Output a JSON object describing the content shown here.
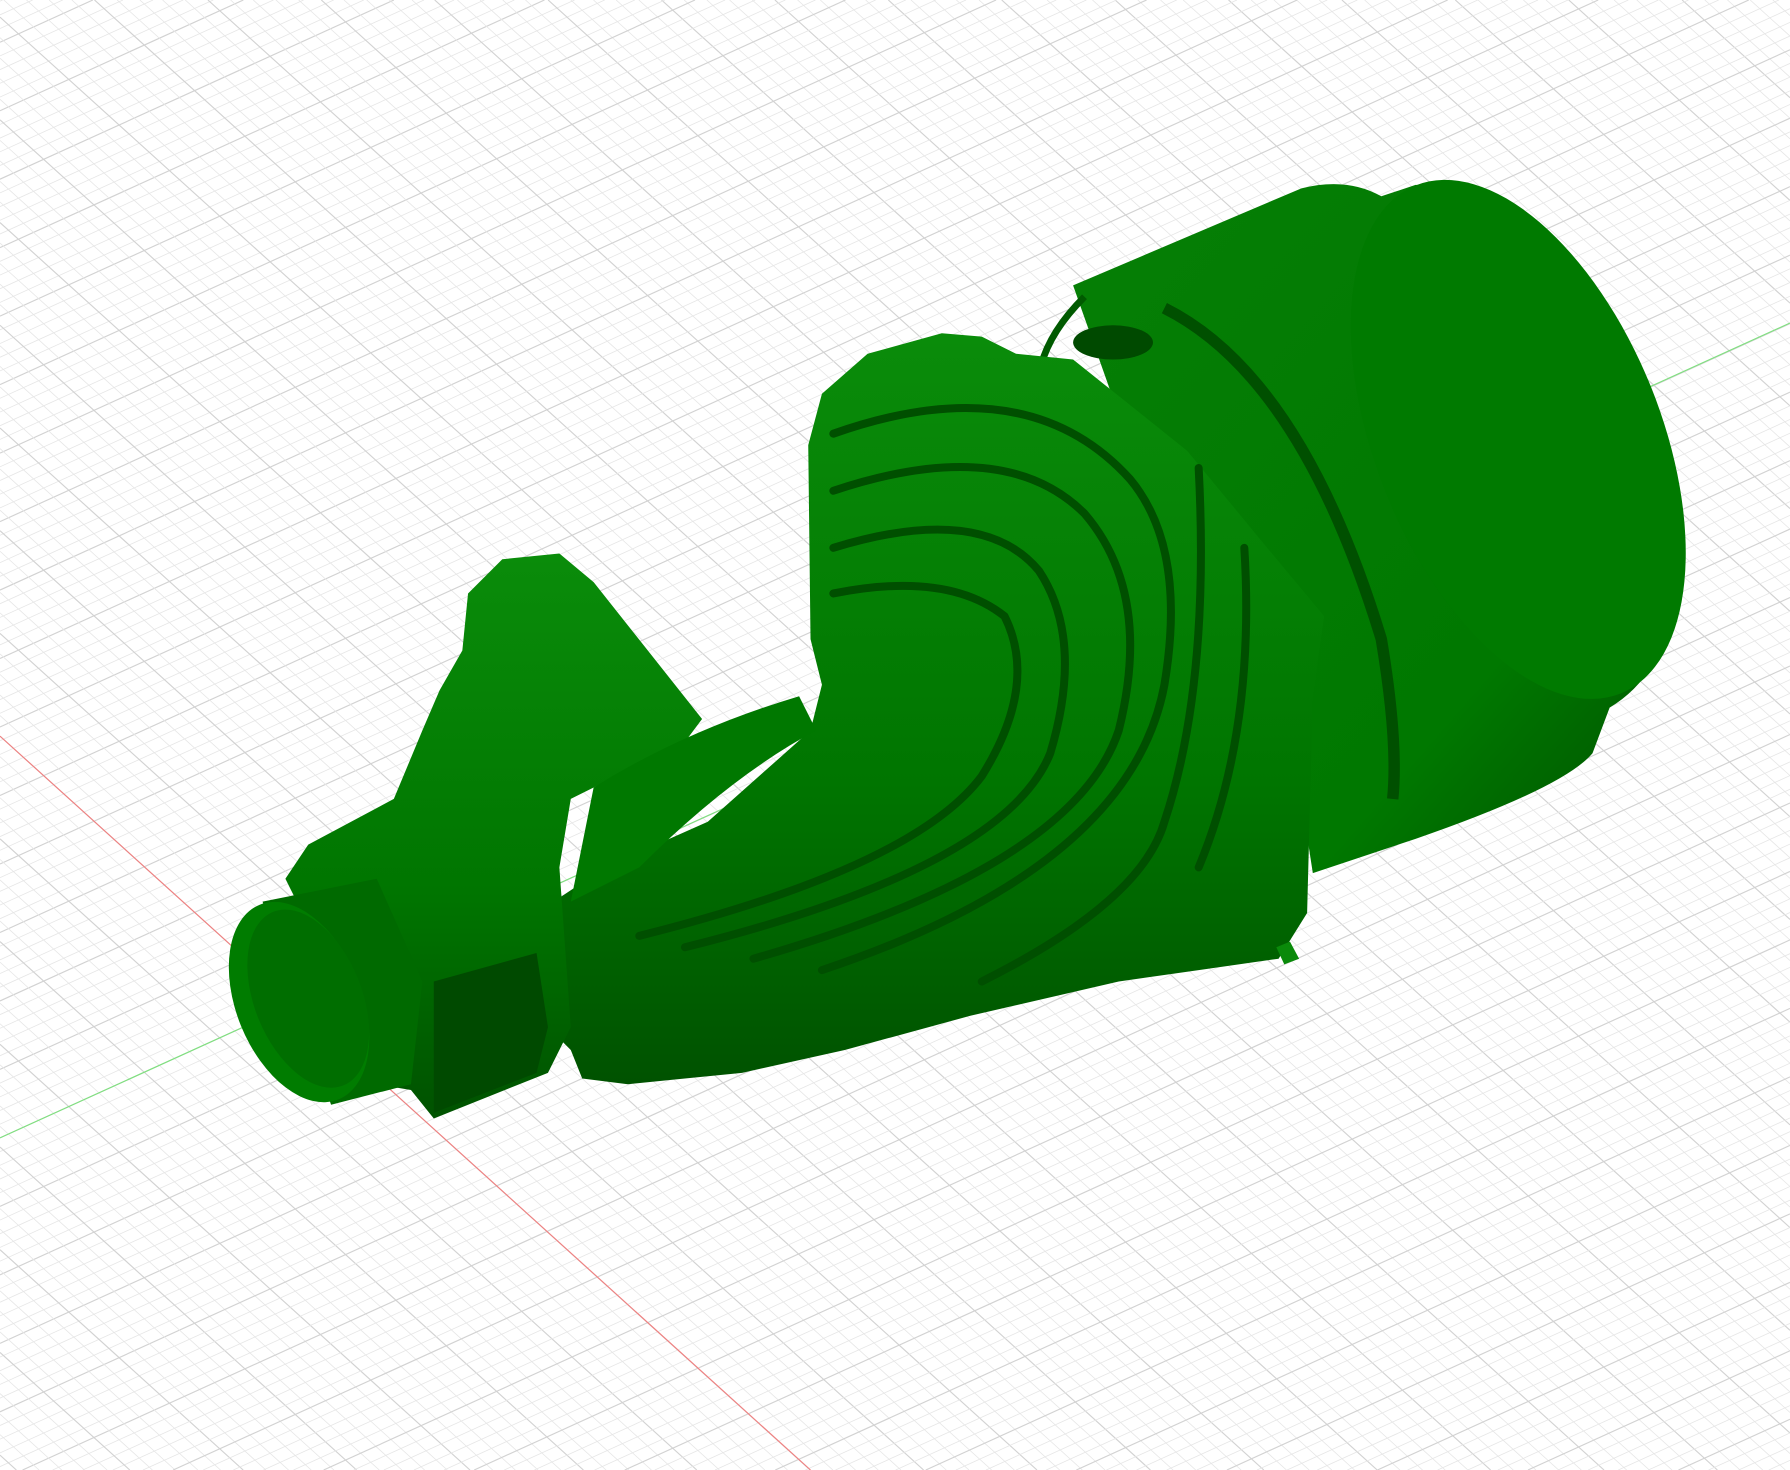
{
  "viewport": {
    "background": "#ffffff",
    "grid_minor_color": "#e6e6e6",
    "grid_major_color": "#d2d2d2",
    "x_axis_color": "#f08080",
    "y_axis_color": "#7fe07f",
    "model_color": "#007d00",
    "model_shadow_color": "#004a00",
    "model_highlight_color": "#1a9a1a"
  },
  "model": {
    "name_icon": "green-mechanical-part-3d-model"
  }
}
